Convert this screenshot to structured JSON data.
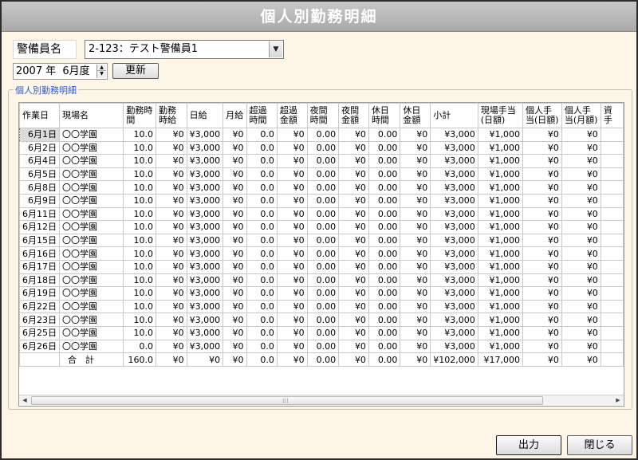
{
  "window": {
    "title": "個人別勤務明細"
  },
  "guard": {
    "label": "警備員名",
    "selected": "2-123：テスト警備員1",
    "arrow_icon": "chevron-down-icon"
  },
  "period": {
    "year": "2007",
    "year_unit": "年",
    "month": "6",
    "month_unit": "月度",
    "refresh_label": "更新"
  },
  "group": {
    "legend": "個人別勤務明細"
  },
  "table": {
    "headers": [
      "作業日",
      "現場名",
      "勤務時間",
      "勤務時給",
      "日給",
      "月給",
      "超過時間",
      "超過金額",
      "夜間時間",
      "夜間金額",
      "休日時間",
      "休日金額",
      "小計",
      "現場手当(日額)",
      "個人手当(日額)",
      "個人手当(月額)",
      "資手"
    ],
    "rows": [
      [
        "6月1日",
        "〇〇学園",
        "10.0",
        "¥0",
        "¥3,000",
        "¥0",
        "0.0",
        "¥0",
        "0.00",
        "¥0",
        "0.00",
        "¥0",
        "¥3,000",
        "¥1,000",
        "¥0",
        "¥0",
        ""
      ],
      [
        "6月2日",
        "〇〇学園",
        "10.0",
        "¥0",
        "¥3,000",
        "¥0",
        "0.0",
        "¥0",
        "0.00",
        "¥0",
        "0.00",
        "¥0",
        "¥3,000",
        "¥1,000",
        "¥0",
        "¥0",
        ""
      ],
      [
        "6月4日",
        "〇〇学園",
        "10.0",
        "¥0",
        "¥3,000",
        "¥0",
        "0.0",
        "¥0",
        "0.00",
        "¥0",
        "0.00",
        "¥0",
        "¥3,000",
        "¥1,000",
        "¥0",
        "¥0",
        ""
      ],
      [
        "6月5日",
        "〇〇学園",
        "10.0",
        "¥0",
        "¥3,000",
        "¥0",
        "0.0",
        "¥0",
        "0.00",
        "¥0",
        "0.00",
        "¥0",
        "¥3,000",
        "¥1,000",
        "¥0",
        "¥0",
        ""
      ],
      [
        "6月8日",
        "〇〇学園",
        "10.0",
        "¥0",
        "¥3,000",
        "¥0",
        "0.0",
        "¥0",
        "0.00",
        "¥0",
        "0.00",
        "¥0",
        "¥3,000",
        "¥1,000",
        "¥0",
        "¥0",
        ""
      ],
      [
        "6月9日",
        "〇〇学園",
        "10.0",
        "¥0",
        "¥3,000",
        "¥0",
        "0.0",
        "¥0",
        "0.00",
        "¥0",
        "0.00",
        "¥0",
        "¥3,000",
        "¥1,000",
        "¥0",
        "¥0",
        ""
      ],
      [
        "6月11日",
        "〇〇学園",
        "10.0",
        "¥0",
        "¥3,000",
        "¥0",
        "0.0",
        "¥0",
        "0.00",
        "¥0",
        "0.00",
        "¥0",
        "¥3,000",
        "¥1,000",
        "¥0",
        "¥0",
        ""
      ],
      [
        "6月12日",
        "〇〇学園",
        "10.0",
        "¥0",
        "¥3,000",
        "¥0",
        "0.0",
        "¥0",
        "0.00",
        "¥0",
        "0.00",
        "¥0",
        "¥3,000",
        "¥1,000",
        "¥0",
        "¥0",
        ""
      ],
      [
        "6月15日",
        "〇〇学園",
        "10.0",
        "¥0",
        "¥3,000",
        "¥0",
        "0.0",
        "¥0",
        "0.00",
        "¥0",
        "0.00",
        "¥0",
        "¥3,000",
        "¥1,000",
        "¥0",
        "¥0",
        ""
      ],
      [
        "6月16日",
        "〇〇学園",
        "10.0",
        "¥0",
        "¥3,000",
        "¥0",
        "0.0",
        "¥0",
        "0.00",
        "¥0",
        "0.00",
        "¥0",
        "¥3,000",
        "¥1,000",
        "¥0",
        "¥0",
        ""
      ],
      [
        "6月17日",
        "〇〇学園",
        "10.0",
        "¥0",
        "¥3,000",
        "¥0",
        "0.0",
        "¥0",
        "0.00",
        "¥0",
        "0.00",
        "¥0",
        "¥3,000",
        "¥1,000",
        "¥0",
        "¥0",
        ""
      ],
      [
        "6月18日",
        "〇〇学園",
        "10.0",
        "¥0",
        "¥3,000",
        "¥0",
        "0.0",
        "¥0",
        "0.00",
        "¥0",
        "0.00",
        "¥0",
        "¥3,000",
        "¥1,000",
        "¥0",
        "¥0",
        ""
      ],
      [
        "6月19日",
        "〇〇学園",
        "10.0",
        "¥0",
        "¥3,000",
        "¥0",
        "0.0",
        "¥0",
        "0.00",
        "¥0",
        "0.00",
        "¥0",
        "¥3,000",
        "¥1,000",
        "¥0",
        "¥0",
        ""
      ],
      [
        "6月22日",
        "〇〇学園",
        "10.0",
        "¥0",
        "¥3,000",
        "¥0",
        "0.0",
        "¥0",
        "0.00",
        "¥0",
        "0.00",
        "¥0",
        "¥3,000",
        "¥1,000",
        "¥0",
        "¥0",
        ""
      ],
      [
        "6月23日",
        "〇〇学園",
        "10.0",
        "¥0",
        "¥3,000",
        "¥0",
        "0.0",
        "¥0",
        "0.00",
        "¥0",
        "0.00",
        "¥0",
        "¥3,000",
        "¥1,000",
        "¥0",
        "¥0",
        ""
      ],
      [
        "6月25日",
        "〇〇学園",
        "10.0",
        "¥0",
        "¥3,000",
        "¥0",
        "0.0",
        "¥0",
        "0.00",
        "¥0",
        "0.00",
        "¥0",
        "¥3,000",
        "¥1,000",
        "¥0",
        "¥0",
        ""
      ],
      [
        "6月26日",
        "〇〇学園",
        "0.0",
        "¥0",
        "¥3,000",
        "¥0",
        "0.0",
        "¥0",
        "0.00",
        "¥0",
        "0.00",
        "¥0",
        "¥3,000",
        "¥1,000",
        "¥0",
        "¥0",
        ""
      ]
    ],
    "total": [
      "",
      "合　計",
      "160.0",
      "¥0",
      "¥0",
      "¥0",
      "0.0",
      "¥0",
      "0.00",
      "¥0",
      "0.00",
      "¥0",
      "¥102,000",
      "¥17,000",
      "¥0",
      "¥0",
      ""
    ],
    "selected_row": 0
  },
  "buttons": {
    "output": "出力",
    "close": "閉じる"
  },
  "colors": {
    "legend": "#2a5ad8",
    "window_bg": "#fdf6e6",
    "titlebar": "#b8b8b8"
  }
}
